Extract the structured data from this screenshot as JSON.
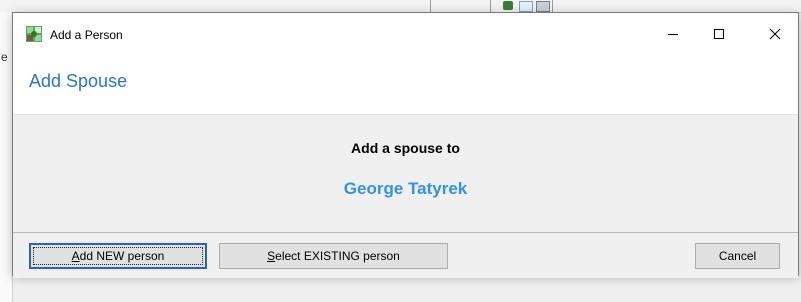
{
  "window": {
    "title": "Add a Person",
    "minimize_glyph": "—",
    "maximize_glyph": "☐",
    "close_glyph": "✕",
    "app_icon": "tree-icon"
  },
  "header": {
    "title": "Add Spouse"
  },
  "content": {
    "prompt": "Add a spouse to",
    "person_name": "George Tatyrek"
  },
  "buttons": {
    "add_new": {
      "access_key": "A",
      "rest": "dd NEW person"
    },
    "select_existing": {
      "access_key": "S",
      "rest": "elect EXISTING person"
    },
    "cancel": "Cancel"
  },
  "background": {
    "left_fragment": "e"
  },
  "colors": {
    "accent_title": "#2f73c2",
    "person_name": "#3392e6",
    "default_button_border": "#2a62b8"
  }
}
